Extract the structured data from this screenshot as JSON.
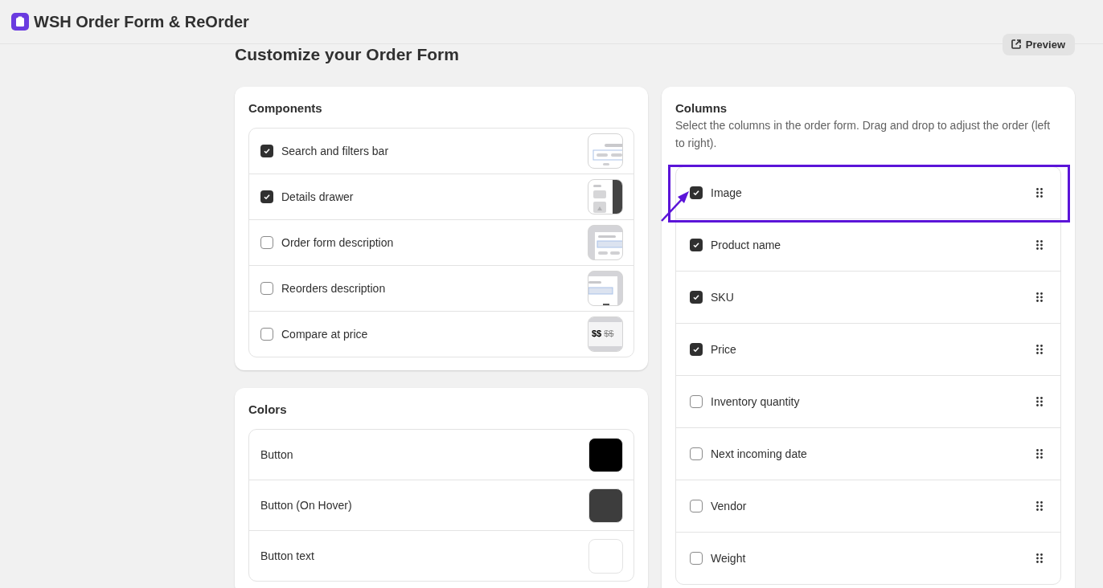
{
  "app": {
    "title": "WSH Order Form & ReOrder"
  },
  "page": {
    "title": "Customize your Order Form",
    "preview_button": "Preview"
  },
  "components": {
    "title": "Components",
    "items": [
      {
        "label": "Search and filters bar",
        "checked": true,
        "kind": "search"
      },
      {
        "label": "Details drawer",
        "checked": true,
        "kind": "drawer"
      },
      {
        "label": "Order form description",
        "checked": false,
        "kind": "description"
      },
      {
        "label": "Reorders description",
        "checked": false,
        "kind": "reorders"
      },
      {
        "label": "Compare at price",
        "checked": false,
        "kind": "price",
        "preview_text": "$$",
        "preview_struck": "$$"
      }
    ]
  },
  "colors": {
    "title": "Colors",
    "items": [
      {
        "label": "Button",
        "color": "#000000"
      },
      {
        "label": "Button (On Hover)",
        "color": "#3d3d3d"
      },
      {
        "label": "Button text",
        "color": "#ffffff"
      }
    ]
  },
  "columns": {
    "title": "Columns",
    "description": "Select the columns in the order form. Drag and drop to adjust the order (left to right).",
    "items": [
      {
        "label": "Image",
        "checked": true,
        "highlighted": true
      },
      {
        "label": "Product name",
        "checked": true,
        "highlighted": false
      },
      {
        "label": "SKU",
        "checked": true,
        "highlighted": false
      },
      {
        "label": "Price",
        "checked": true,
        "highlighted": false
      },
      {
        "label": "Inventory quantity",
        "checked": false,
        "highlighted": false
      },
      {
        "label": "Next incoming date",
        "checked": false,
        "highlighted": false
      },
      {
        "label": "Vendor",
        "checked": false,
        "highlighted": false
      },
      {
        "label": "Weight",
        "checked": false,
        "highlighted": false
      }
    ]
  }
}
